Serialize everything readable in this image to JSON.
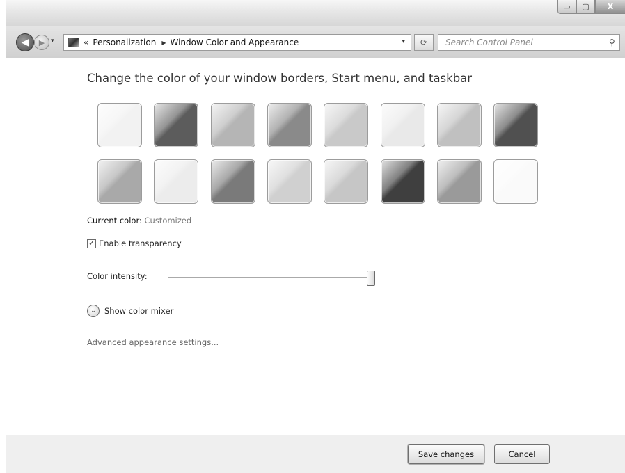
{
  "window": {
    "caption_buttons": {
      "minimize": "▭",
      "maximize": "▢",
      "close": "X"
    }
  },
  "nav": {
    "back_icon": "◀",
    "forward_icon": "▶",
    "recent_icon": "▾",
    "address": {
      "chevron": "«",
      "crumbs": [
        "Personalization",
        "Window Color and Appearance"
      ],
      "separator": "▶",
      "dropdown_icon": "▾"
    },
    "refresh_icon": "⟳",
    "search": {
      "placeholder": "Search Control Panel",
      "icon": "⚲"
    }
  },
  "main": {
    "heading": "Change the color of your window borders, Start menu, and taskbar",
    "swatch_rows": [
      [
        "#f2f2f2",
        "#5c5c5c",
        "#b5b5b5",
        "#8a8a8a",
        "#c9c9c9",
        "#e9e9e9",
        "#c0c0c0",
        "#505050"
      ],
      [
        "#a9a9a9",
        "#ececec",
        "#7a7a7a",
        "#d0d0d0",
        "#c6c6c6",
        "#3f3f3f",
        "#9a9a9a",
        "#fafafa"
      ]
    ],
    "current_color_label": "Current color:",
    "current_color_value": "Customized",
    "transparency_check": "✓",
    "transparency_label": "Enable transparency",
    "transparency_checked": true,
    "intensity_label": "Color intensity:",
    "intensity_value": 1.0,
    "mixer_icon": "⌄",
    "mixer_label": "Show color mixer",
    "advanced_link": "Advanced appearance settings..."
  },
  "footer": {
    "save_label": "Save changes",
    "cancel_label": "Cancel"
  }
}
